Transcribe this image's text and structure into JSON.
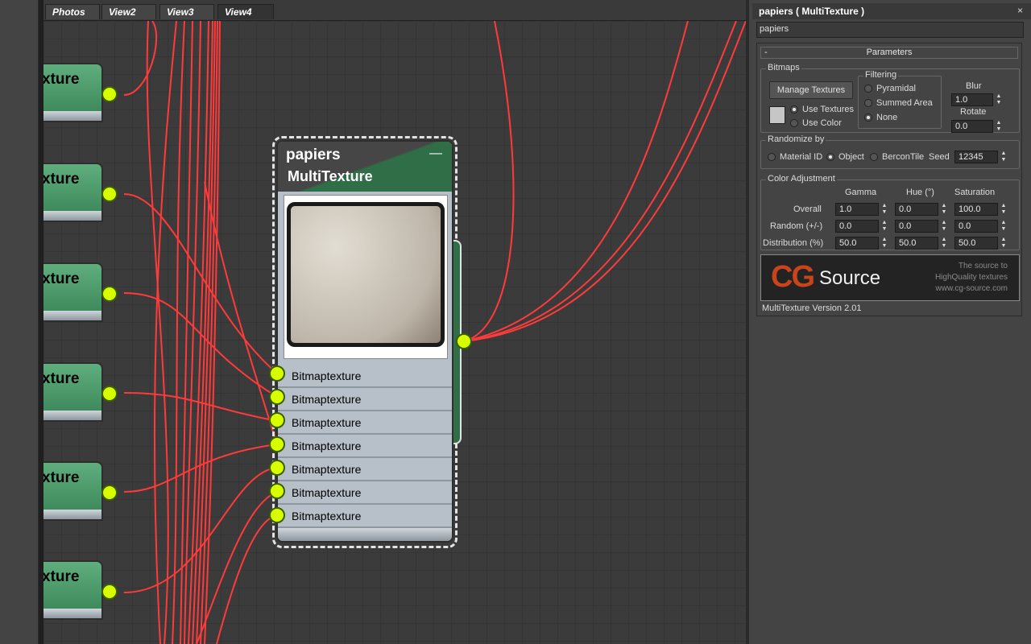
{
  "tabs": [
    {
      "label": "Photos",
      "active": false
    },
    {
      "label": "View2",
      "active": false
    },
    {
      "label": "View3",
      "active": false
    },
    {
      "label": "View4",
      "active": true
    }
  ],
  "left_nodes": {
    "label_fragment": "xture"
  },
  "main_node": {
    "title": "papiers",
    "subtitle": "MultiTexture",
    "minimize": "—",
    "slots": [
      "Bitmaptexture",
      "Bitmaptexture",
      "Bitmaptexture",
      "Bitmaptexture",
      "Bitmaptexture",
      "Bitmaptexture",
      "Bitmaptexture"
    ]
  },
  "panel": {
    "title": "papiers  ( MultiTexture )",
    "close": "×",
    "name_value": "papiers",
    "rollout": "Parameters",
    "rollout_toggle": "-",
    "bitmaps": {
      "group": "Bitmaps",
      "manage_button": "Manage Textures",
      "use_textures": "Use Textures",
      "use_color": "Use Color",
      "filtering": {
        "group": "Filtering",
        "options": [
          "Pyramidal",
          "Summed Area",
          "None"
        ],
        "selected": "None"
      },
      "blur_label": "Blur",
      "blur_value": "1.0",
      "rotate_label": "Rotate",
      "rotate_value": "0.0"
    },
    "randomize": {
      "group": "Randomize by",
      "options": [
        "Material ID",
        "Object",
        "BerconTile"
      ],
      "selected": "Object",
      "seed_label": "Seed",
      "seed_value": "12345"
    },
    "color_adjustment": {
      "group": "Color Adjustment",
      "columns": [
        "Gamma",
        "Hue (°)",
        "Saturation"
      ],
      "rows": [
        {
          "label": "Overall",
          "values": [
            "1.0",
            "0.0",
            "100.0"
          ]
        },
        {
          "label": "Random (+/-)",
          "values": [
            "0.0",
            "0.0",
            "0.0"
          ]
        },
        {
          "label": "Distribution (%)",
          "values": [
            "50.0",
            "50.0",
            "50.0"
          ]
        }
      ]
    },
    "logo": {
      "cg": "CG",
      "source": "Source",
      "tagline1": "The source to",
      "tagline2": "HighQuality textures",
      "url": "www.cg-source.com"
    },
    "version": "MultiTexture Version 2.01"
  },
  "colors": {
    "wire": "#ff3a3a",
    "port": "#d8ff00",
    "node_green": "#4f9c6c",
    "header_green": "#2f6e46"
  }
}
